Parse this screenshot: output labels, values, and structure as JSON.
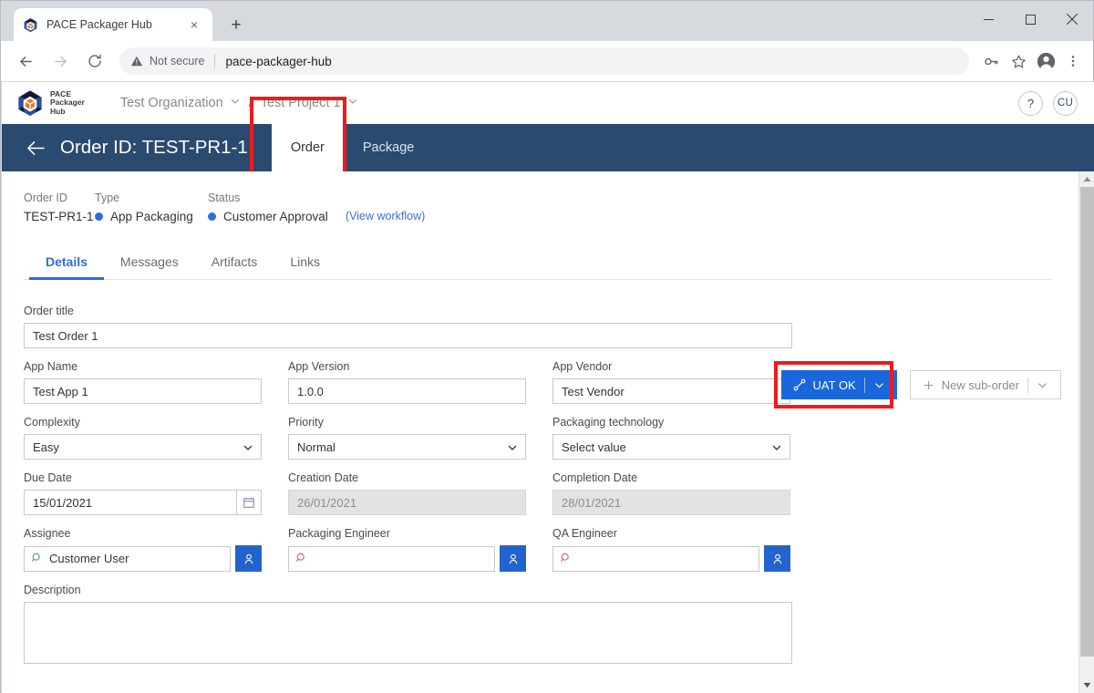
{
  "browser": {
    "tab": {
      "title": "PACE Packager Hub",
      "favicon": "pace-cube-icon",
      "close": "×"
    },
    "newtab_label": "+",
    "window_controls": {
      "minimize": "minimize-icon",
      "maximize": "maximize-icon",
      "close": "close-icon"
    },
    "nav": {
      "back": "back-arrow-icon",
      "forward": "forward-arrow-icon",
      "reload": "reload-icon"
    },
    "omnibox": {
      "security_label": "Not secure",
      "url": "pace-packager-hub",
      "divider": "|"
    },
    "toolbar_icons": {
      "key": "key-icon",
      "star": "star-icon",
      "profile": "profile-avatar-icon",
      "menu": "three-dot-menu-icon"
    }
  },
  "app": {
    "logo": {
      "line1": "PACE",
      "line2": "Packager",
      "line3": "Hub"
    },
    "breadcrumb": {
      "organization": "Test Organization",
      "separator": "/",
      "project": "Test Project 1"
    },
    "help_label": "?",
    "avatar_label": "CU"
  },
  "orderbar": {
    "back": "back-arrow-icon",
    "title": "Order ID: TEST-PR1-1",
    "tabs": [
      {
        "label": "Order",
        "active": true,
        "highlighted": true
      },
      {
        "label": "Package",
        "active": false,
        "highlighted": false
      }
    ]
  },
  "meta": {
    "order_id": {
      "label": "Order ID",
      "value": "TEST-PR1-1"
    },
    "type": {
      "label": "Type",
      "value": "App Packaging"
    },
    "status": {
      "label": "Status",
      "value": "Customer Approval"
    },
    "workflow_link": "(View workflow)"
  },
  "actions": {
    "primary": {
      "label": "UAT OK",
      "icon": "workflow-icon",
      "caret": "chevron-down-icon",
      "highlighted": true
    },
    "secondary": {
      "label": "New sub-order",
      "icon": "plus-icon",
      "caret": "chevron-down-icon"
    }
  },
  "tabs": [
    {
      "label": "Details",
      "active": true
    },
    {
      "label": "Messages",
      "active": false
    },
    {
      "label": "Artifacts",
      "active": false
    },
    {
      "label": "Links",
      "active": false
    }
  ],
  "form": {
    "order_title": {
      "label": "Order title",
      "value": "Test Order 1"
    },
    "app_name": {
      "label": "App Name",
      "value": "Test App 1"
    },
    "app_version": {
      "label": "App Version",
      "value": "1.0.0"
    },
    "app_vendor": {
      "label": "App Vendor",
      "value": "Test Vendor"
    },
    "complexity": {
      "label": "Complexity",
      "value": "Easy"
    },
    "priority": {
      "label": "Priority",
      "value": "Normal"
    },
    "packaging_technology": {
      "label": "Packaging technology",
      "value": "Select value"
    },
    "due_date": {
      "label": "Due Date",
      "value": "15/01/2021"
    },
    "creation_date": {
      "label": "Creation Date",
      "value": "26/01/2021"
    },
    "completion_date": {
      "label": "Completion Date",
      "value": "28/01/2021"
    },
    "assignee": {
      "label": "Assignee",
      "value": "Customer User"
    },
    "packaging_engineer": {
      "label": "Packaging Engineer",
      "value": ""
    },
    "qa_engineer": {
      "label": "QA Engineer",
      "value": ""
    },
    "description": {
      "label": "Description",
      "value": ""
    }
  },
  "colors": {
    "header_blue": "#2b4a70",
    "primary_button": "#1a66dd",
    "accent_blue": "#2f6ce0",
    "annotation_red": "#ee1b1b",
    "logo_orange": "#ef7622",
    "logo_blue": "#2b4f9e"
  }
}
